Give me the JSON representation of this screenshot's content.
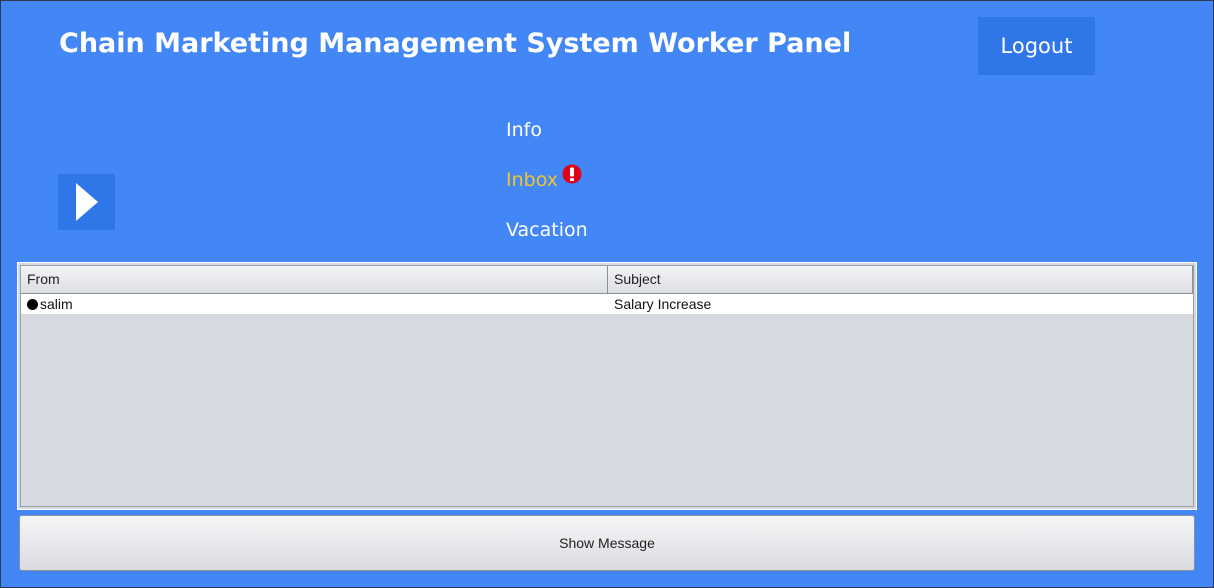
{
  "header": {
    "title": "Chain Marketing Management System Worker Panel",
    "logout_label": "Logout"
  },
  "sidebar_toggle": {
    "icon": "play-arrow-icon"
  },
  "nav": {
    "items": [
      {
        "label": "Info"
      },
      {
        "label": "Inbox",
        "active": true,
        "alert_icon": "exclamation-alert-icon"
      },
      {
        "label": "Vacation"
      }
    ]
  },
  "inbox_table": {
    "columns": [
      "From",
      "Subject"
    ],
    "rows": [
      {
        "from": "salim",
        "subject": "Salary Increase",
        "unread": true
      }
    ]
  },
  "actions": {
    "show_message_label": "Show Message"
  },
  "colors": {
    "background": "#4287f5",
    "button": "#2f76e8",
    "active_nav": "#f4c430",
    "alert": "#e0001a"
  }
}
